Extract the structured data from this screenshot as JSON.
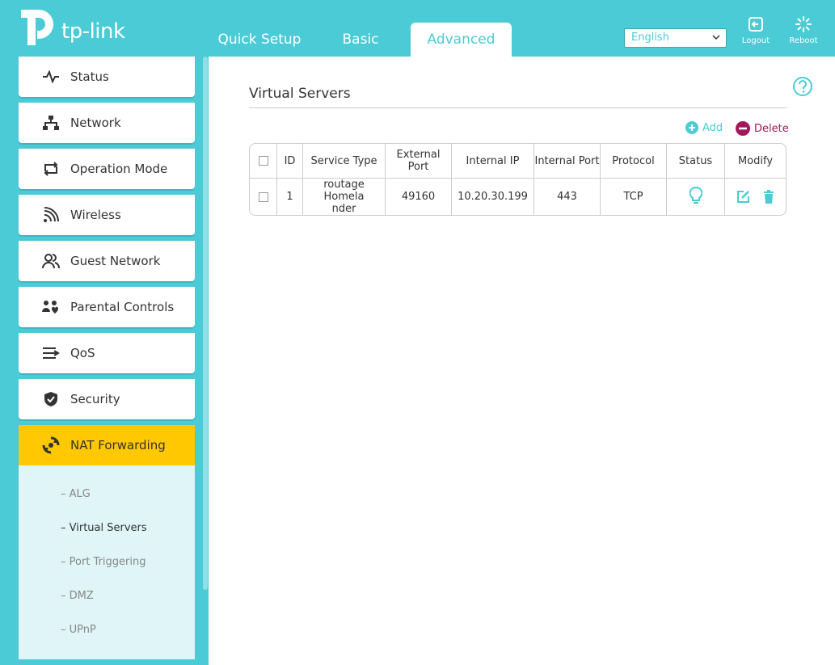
{
  "brand": {
    "name": "tp-link"
  },
  "nav": {
    "tabs": [
      {
        "label": "Quick Setup"
      },
      {
        "label": "Basic"
      },
      {
        "label": "Advanced"
      }
    ]
  },
  "language": {
    "selected": "English"
  },
  "header_buttons": {
    "logout": "Logout",
    "reboot": "Reboot"
  },
  "sidebar": {
    "items": [
      {
        "label": "Status",
        "icon": "pulse-icon"
      },
      {
        "label": "Network",
        "icon": "network-icon"
      },
      {
        "label": "Operation Mode",
        "icon": "swap-icon"
      },
      {
        "label": "Wireless",
        "icon": "wifi-icon"
      },
      {
        "label": "Guest Network",
        "icon": "guest-icon"
      },
      {
        "label": "Parental Controls",
        "icon": "family-icon"
      },
      {
        "label": "QoS",
        "icon": "qos-icon"
      },
      {
        "label": "Security",
        "icon": "shield-icon"
      },
      {
        "label": "NAT Forwarding",
        "icon": "nat-icon"
      }
    ],
    "submenu": [
      {
        "label": "ALG"
      },
      {
        "label": "Virtual Servers"
      },
      {
        "label": "Port Triggering"
      },
      {
        "label": "DMZ"
      },
      {
        "label": "UPnP"
      }
    ]
  },
  "page": {
    "title": "Virtual Servers",
    "add_label": "Add",
    "delete_label": "Delete"
  },
  "table": {
    "headers": [
      "ID",
      "Service Type",
      "External Port",
      "Internal IP",
      "Internal Port",
      "Protocol",
      "Status",
      "Modify"
    ],
    "rows": [
      {
        "id": "1",
        "service_line1": "routage Homela",
        "service_line2": "nder",
        "external_port": "49160",
        "internal_ip": "10.20.30.199",
        "internal_port": "443",
        "protocol": "TCP"
      }
    ]
  },
  "colors": {
    "accent": "#4acbd6",
    "active": "#ffc800",
    "delete": "#a3185a"
  }
}
